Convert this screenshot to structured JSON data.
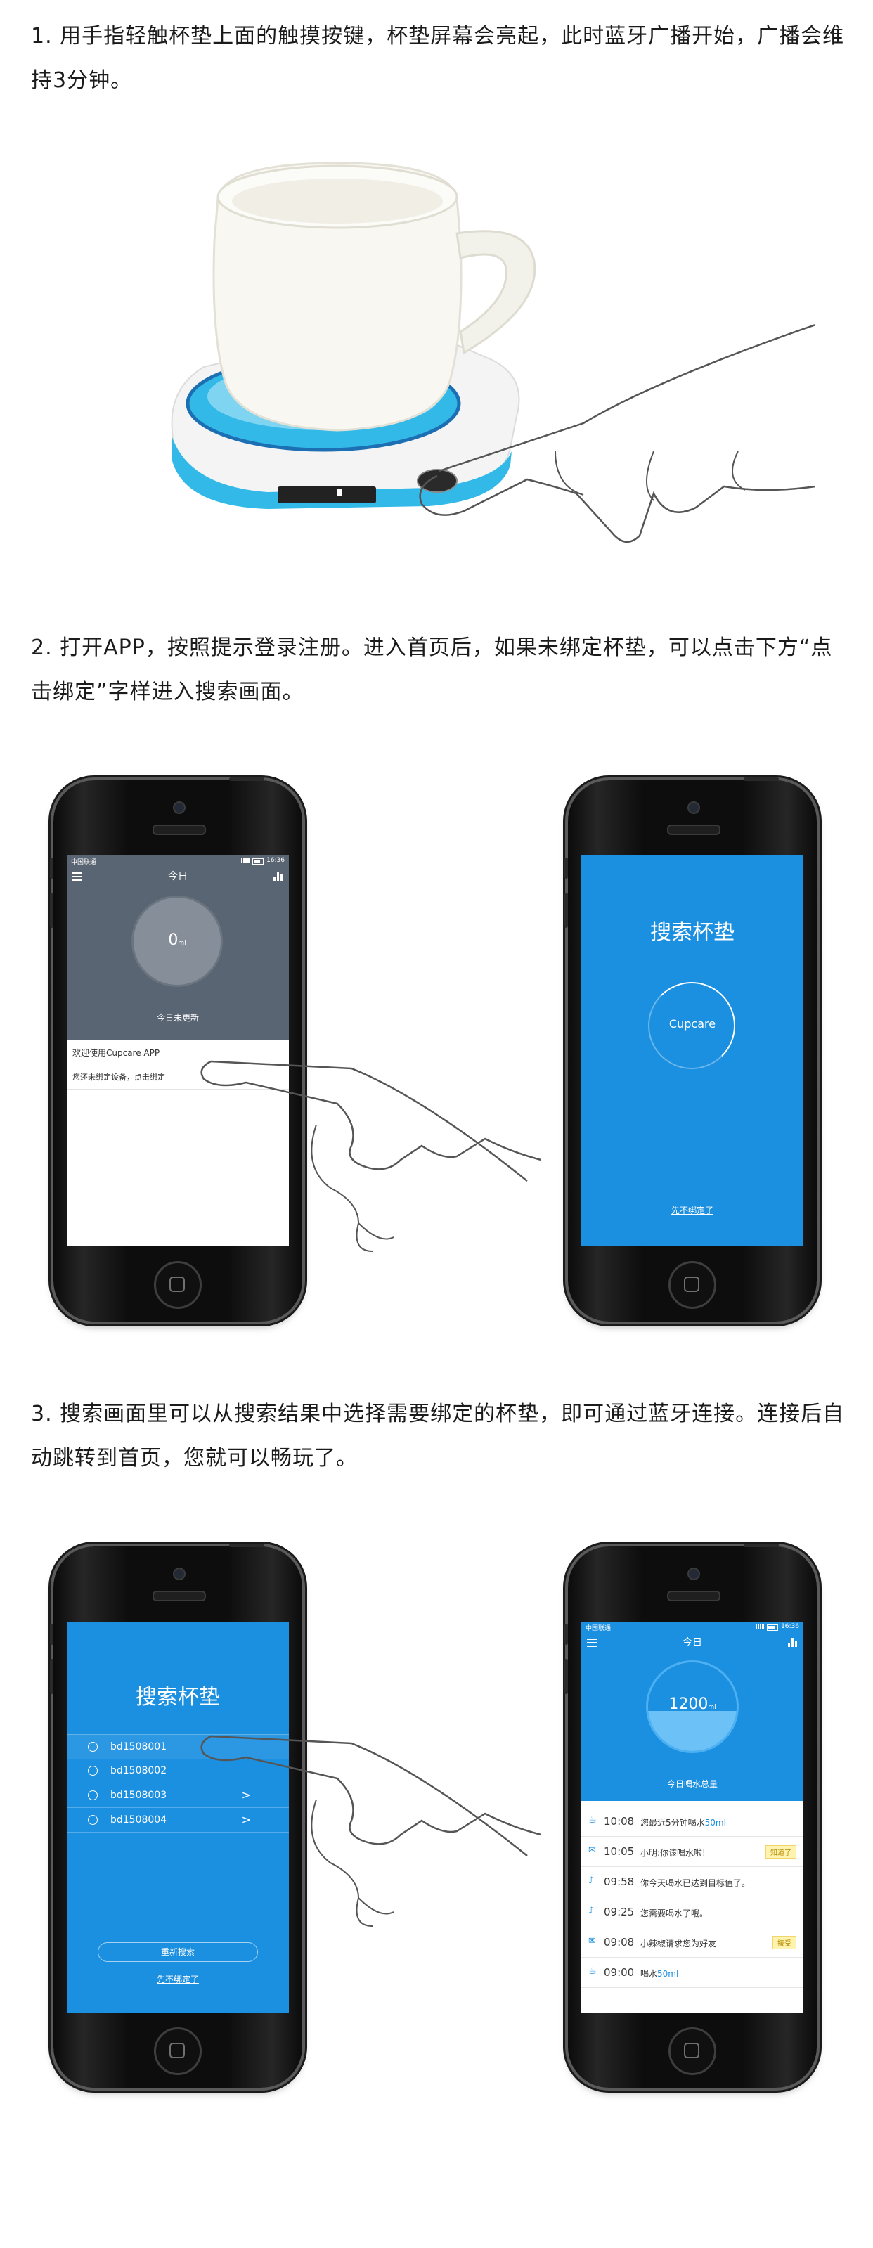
{
  "steps": [
    {
      "text": "1. 用手指轻触杯垫上面的触摸按键，杯垫屏幕会亮起，此时蓝牙广播开始，广播会维持3分钟。"
    },
    {
      "text": "2. 打开APP，按照提示登录注册。进入首页后，如果未绑定杯垫，可以点击下方“点击绑定”字样进入搜索画面。"
    },
    {
      "text": "3. 搜索画面里可以从搜索结果中选择需要绑定的杯垫，即可通过蓝牙连接。连接后自动跳转到首页，您就可以畅玩了。"
    }
  ],
  "status_bar": {
    "carrier": "中国联通",
    "time": "16:36"
  },
  "screen_home_unbound": {
    "title": "今日",
    "value": "0",
    "unit": "ml",
    "status": "今日未更新",
    "welcome": "欢迎使用Cupcare APP",
    "bind_prompt": "您还未绑定设备，点击绑定"
  },
  "screen_search": {
    "title": "搜索杯垫",
    "spinner_label": "Cupcare",
    "skip_link": "先不绑定了"
  },
  "screen_results": {
    "title": "搜索杯垫",
    "devices": [
      {
        "name": "bd1508001",
        "chevron": ""
      },
      {
        "name": "bd1508002",
        "chevron": ""
      },
      {
        "name": "bd1508003",
        "chevron": ">"
      },
      {
        "name": "bd1508004",
        "chevron": ">"
      }
    ],
    "rescan": "重新搜索",
    "skip_link": "先不绑定了"
  },
  "screen_home_bound": {
    "title": "今日",
    "value": "1200",
    "unit": "ml",
    "fill_fraction": 0.45,
    "caption": "今日喝水总量",
    "feed": [
      {
        "icon": "cup-icon",
        "time": "10:08",
        "text": "您最近5分钟喝水",
        "highlight": "50ml",
        "tag": ""
      },
      {
        "icon": "mail-icon",
        "time": "10:05",
        "text": "小明:你该喝水啦!",
        "highlight": "",
        "tag": "知道了"
      },
      {
        "icon": "speaker-icon",
        "time": "09:58",
        "text": "你今天喝水已达到目标值了。",
        "highlight": "",
        "tag": ""
      },
      {
        "icon": "speaker-icon",
        "time": "09:25",
        "text": "您需要喝水了哦。",
        "highlight": "",
        "tag": ""
      },
      {
        "icon": "mail-icon",
        "time": "09:08",
        "text": "小辣椒请求您为好友",
        "highlight": "",
        "tag": "接受"
      },
      {
        "icon": "cup-icon",
        "time": "09:00",
        "text": "喝水",
        "highlight": "50ml",
        "tag": ""
      }
    ]
  },
  "colors": {
    "app_blue": "#1b8fe0",
    "slate": "#5a6573",
    "coaster_ring": "#33b9e8"
  }
}
